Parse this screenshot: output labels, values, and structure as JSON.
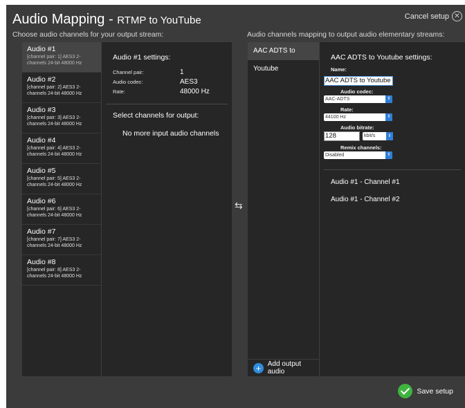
{
  "header": {
    "title": "Audio Mapping - ",
    "subtitle": "RTMP to YouTube",
    "cancel_label": "Cancel setup",
    "left_section_label": "Choose audio channels for your output stream:",
    "right_section_label": "Audio channels mapping to output audio elementary streams:"
  },
  "inputs": [
    {
      "name": "Audio #1",
      "desc": "[channel pair: 1] AES3 2-channels 24-bit 48000 Hz"
    },
    {
      "name": "Audio #2",
      "desc": "[channel pair: 2] AES3 2-channels 24-bit 48000 Hz"
    },
    {
      "name": "Audio #3",
      "desc": "[channel pair: 3] AES3 2-channels 24-bit 48000 Hz"
    },
    {
      "name": "Audio #4",
      "desc": "[channel pair: 4] AES3 2-channels 24-bit 48000 Hz"
    },
    {
      "name": "Audio #5",
      "desc": "[channel pair: 5] AES3 2-channels 24-bit 48000 Hz"
    },
    {
      "name": "Audio #6",
      "desc": "[channel pair: 6] AES3 2-channels 24-bit 48000 Hz"
    },
    {
      "name": "Audio #7",
      "desc": "[channel pair: 7] AES3 2-channels 24-bit 48000 Hz"
    },
    {
      "name": "Audio #8",
      "desc": "[channel pair: 8] AES3 2-channels 24-bit 48000 Hz"
    }
  ],
  "input_settings": {
    "title": "Audio #1 settings:",
    "channel_pair_label": "Channel pair:",
    "channel_pair_value": "1",
    "codec_label": "Audio codec:",
    "codec_value": "AES3",
    "rate_label": "Rate:",
    "rate_value": "48000 Hz",
    "select_title": "Select channels for output:",
    "none_text": "No more input audio channels"
  },
  "swap_icon": "⇆",
  "outputs": {
    "items": [
      "AAC ADTS to Youtube"
    ],
    "add_label": "Add output audio"
  },
  "output_settings": {
    "title": "AAC ADTS to Youtube settings:",
    "name_label": "Name:",
    "name_value": "AAC ADTS to Youtube",
    "codec_label": "Audio codec:",
    "codec_value": "AAC-ADTS",
    "rate_label": "Rate:",
    "rate_value": "44100 Hz",
    "bitrate_label": "Audio bitrate:",
    "bitrate_value": "128",
    "bitrate_unit": "kbit/s",
    "remix_label": "Remix channels:",
    "remix_value": "Disabled",
    "mapped_channels": [
      "Audio #1 - Channel #1",
      "Audio #1 - Channel #2"
    ]
  },
  "footer": {
    "save_label": "Save setup"
  },
  "colors": {
    "dialog_bg": "#3b3b3b",
    "panel_bg": "#262626",
    "accent_blue": "#2f8cdc",
    "save_green": "#3fb43f"
  }
}
